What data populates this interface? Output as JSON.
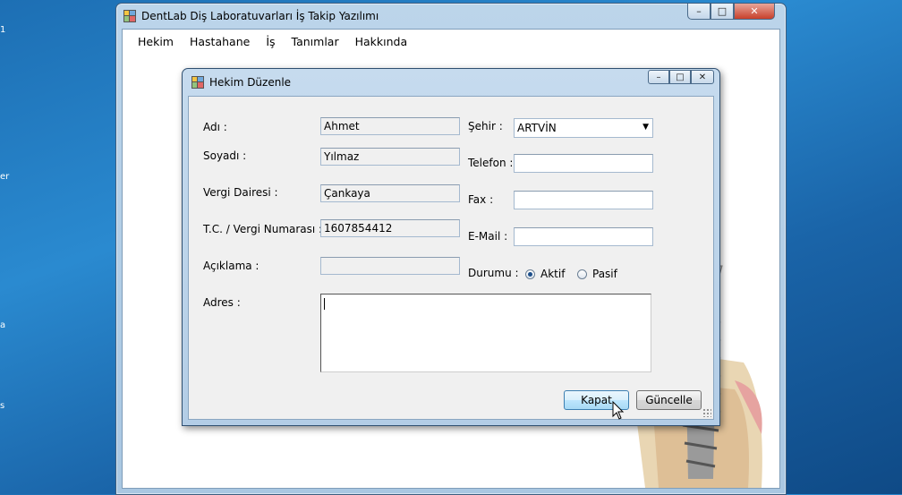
{
  "main_window": {
    "title": "DentLab Diş Laboratuvarları İş Takip Yazılımı",
    "controls": {
      "minimize": "–",
      "maximize": "□",
      "close": "✕"
    }
  },
  "menu": [
    "Hekim",
    "Hastahane",
    "İş",
    "Tanımlar",
    "Hakkında"
  ],
  "dialog": {
    "title": "Hekim Düzenle",
    "fields": {
      "adi": {
        "label": "Adı :",
        "value": "Ahmet"
      },
      "soyadi": {
        "label": "Soyadı :",
        "value": "Yılmaz"
      },
      "vergi_dairesi": {
        "label": "Vergi Dairesi :",
        "value": "Çankaya"
      },
      "tc_vergi": {
        "label": "T.C. / Vergi Numarası :",
        "value": "1607854412"
      },
      "aciklama": {
        "label": "Açıklama :",
        "value": ""
      },
      "adres": {
        "label": "Adres :",
        "value": ""
      },
      "sehir": {
        "label": "Şehir :",
        "value": "ARTVİN"
      },
      "telefon": {
        "label": "Telefon :",
        "value": ""
      },
      "fax": {
        "label": "Fax :",
        "value": ""
      },
      "email": {
        "label": "E-Mail :",
        "value": ""
      },
      "durumu": {
        "label": "Durumu :",
        "options": [
          "Aktif",
          "Pasif"
        ],
        "selected": "Aktif"
      }
    },
    "buttons": {
      "kapat": "Kapat",
      "guncelle": "Güncelle"
    }
  },
  "colors": {
    "desktop": "#1d6fb4",
    "title_bar": "#b8d3ea",
    "dialog_bg": "#f0f0f0"
  }
}
